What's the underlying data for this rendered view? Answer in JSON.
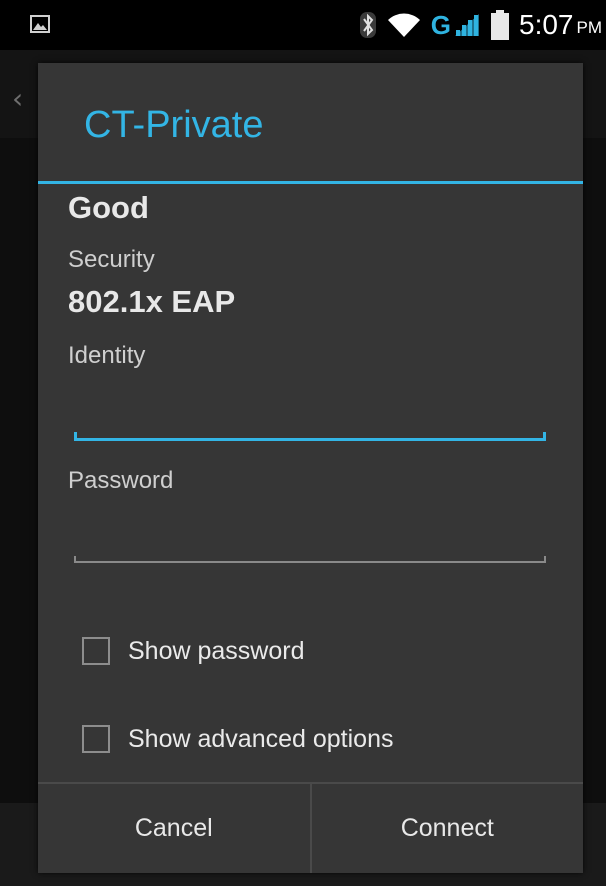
{
  "status_bar": {
    "left_icons": [
      "gallery-icon"
    ],
    "right_icons": [
      "bluetooth-icon",
      "wifi-icon",
      "signal-icon",
      "battery-icon"
    ],
    "network_type": "G",
    "time": "5:07",
    "ampm": "PM",
    "accent_color": "#2fb3e0"
  },
  "dialog": {
    "title": "CT-Private",
    "signal_strength": "Good",
    "security_label": "Security",
    "security_value": "802.1x EAP",
    "identity_label": "Identity",
    "identity_value": "",
    "password_label": "Password",
    "password_value": "",
    "show_password_label": "Show password",
    "show_password_checked": false,
    "show_advanced_label": "Show advanced options",
    "show_advanced_checked": false,
    "cancel_label": "Cancel",
    "connect_label": "Connect",
    "accent_color": "#33b5e5"
  }
}
